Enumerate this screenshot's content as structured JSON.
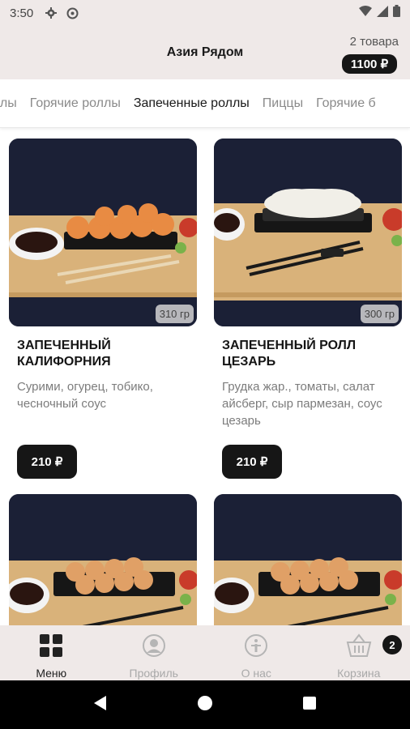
{
  "status_bar": {
    "time": "3:50"
  },
  "header": {
    "title": "Азия Рядом",
    "cart_count": "2 товара",
    "cart_total": "1100 ₽"
  },
  "tabs": [
    {
      "label": "оллы"
    },
    {
      "label": "Горячие роллы"
    },
    {
      "label": "Запеченные роллы",
      "active": true
    },
    {
      "label": "Пиццы"
    },
    {
      "label": "Горячие б"
    }
  ],
  "products": [
    {
      "name": "Запеченный Калифорния",
      "description": "Сурими, огурец, тобико, чесночный соус",
      "weight": "310 гр",
      "price": "210 ₽",
      "image": "sushi-rolls-photo"
    },
    {
      "name": "Запеченный ролл Цезарь",
      "description": "Грудка жар., томаты, салат айсберг, сыр пармезан, соус цезарь",
      "weight": "300 гр",
      "price": "210 ₽",
      "image": "sushi-rolls-photo"
    },
    {
      "image": "sushi-rolls-photo"
    },
    {
      "image": "sushi-rolls-photo"
    }
  ],
  "bottom_nav": [
    {
      "label": "Меню",
      "icon": "grid-icon",
      "active": true
    },
    {
      "label": "Профиль",
      "icon": "profile-icon"
    },
    {
      "label": "О нас",
      "icon": "info-icon"
    },
    {
      "label": "Корзина",
      "icon": "basket-icon",
      "badge": "2"
    }
  ],
  "colors": {
    "header_bg": "#efe9e8",
    "accent_dark": "#161616",
    "text_muted": "#7c7c7c"
  }
}
